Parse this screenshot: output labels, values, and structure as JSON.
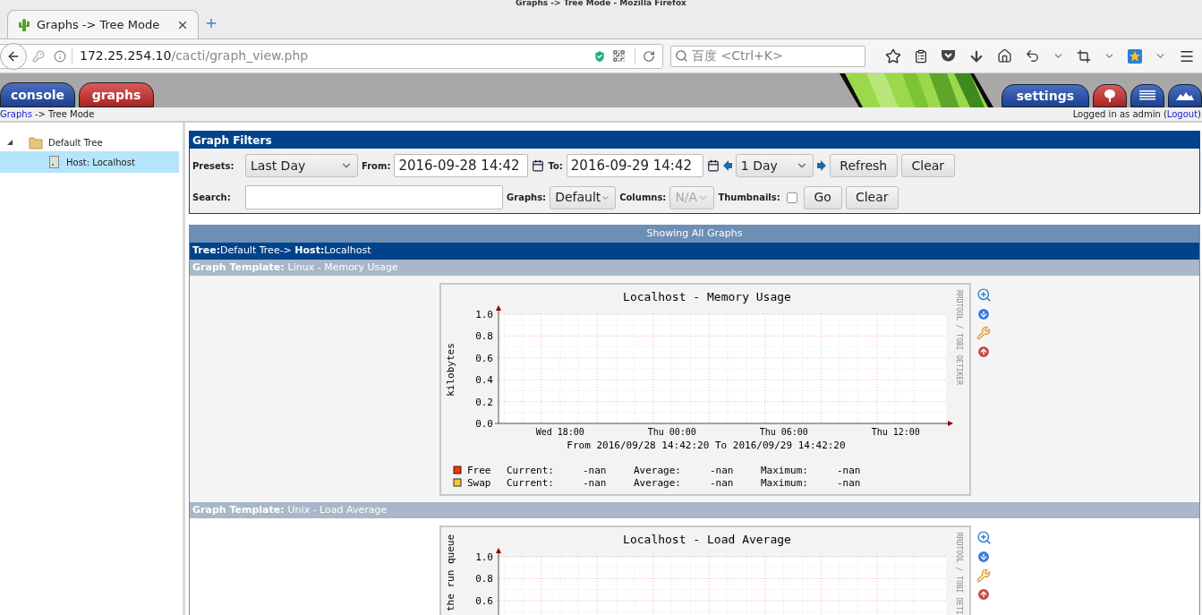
{
  "window": {
    "title": "Graphs -> Tree Mode - Mozilla Firefox"
  },
  "browser": {
    "tabs": [
      {
        "label": "Graphs -> Tree Mode",
        "selected": true
      }
    ],
    "address": {
      "host": "172.25.254.10",
      "path": "/cacti/graph_view.php"
    },
    "search": {
      "placeholder": "百度 <Ctrl+K>"
    }
  },
  "cacti_tabs": [
    {
      "label": "console",
      "selected": false
    },
    {
      "label": "graphs",
      "selected": true
    }
  ],
  "right_tabs": [
    {
      "kind": "text",
      "label": "settings",
      "selected": false
    },
    {
      "kind": "tree",
      "selected": true
    },
    {
      "kind": "list",
      "selected": false
    },
    {
      "kind": "preview",
      "selected": false
    }
  ],
  "breadcrumb": {
    "link": "Graphs",
    "rest": "-> Tree Mode"
  },
  "login": {
    "prefix": "Logged in as admin (",
    "link": "Logout",
    "suffix": ")"
  },
  "tree": [
    {
      "label": "Default Tree",
      "expanded": true,
      "selected": false,
      "children": [
        {
          "label": "Host: Localhost",
          "selected": true
        }
      ]
    }
  ],
  "filters": {
    "title": "Graph Filters",
    "presets_label": "Presets:",
    "preset": "Last Day",
    "from_label": "From:",
    "from": "2016-09-28 14:42",
    "to_label": "To:",
    "to": "2016-09-29 14:42",
    "timespan": "1 Day",
    "buttons": [
      "Refresh",
      "Clear"
    ],
    "search_label": "Search:",
    "graphs_label": "Graphs:",
    "graphs": "Default",
    "columns_label": "Columns:",
    "columns": "N/A",
    "columns_disabled": true,
    "thumbnails_label": "Thumbnails:",
    "thumbnails": false,
    "buttons2": [
      "Go",
      "Clear"
    ]
  },
  "listing": {
    "header": "Showing All Graphs",
    "tree_path": {
      "tree_label": "Tree:",
      "tree": "Default Tree->",
      "host_label": "Host:",
      "host": "Localhost"
    },
    "templates": [
      {
        "label": "Graph Template:",
        "name": "Linux - Memory Usage",
        "graph": {
          "title": "Localhost - Memory Usage",
          "watermark": "RRDTOOL / TOBI OETIKER",
          "subtitle": "From 2016/09/28 14:42:20 To 2016/09/29 14:42:20",
          "chart_data": {
            "type": "line",
            "ylabel": "kilobytes",
            "ylim": [
              0,
              1
            ],
            "grid": true,
            "categories": [
              "Wed 18:00",
              "Thu 00:00",
              "Thu 06:00",
              "Thu 12:00"
            ],
            "yticks": [
              {
                "value": 0,
                "label": "0.0"
              },
              {
                "value": 0.2,
                "label": "0.2"
              },
              {
                "value": 0.4,
                "label": "0.4"
              },
              {
                "value": 0.6,
                "label": "0.6"
              },
              {
                "value": 0.8,
                "label": "0.8"
              },
              {
                "value": 1,
                "label": "1.0"
              }
            ],
            "series": [
              {
                "name": "Free",
                "color": "#ff3300",
                "values": [
                  null,
                  null,
                  null,
                  null
                ]
              },
              {
                "name": "Swap",
                "color": "#ffc73b",
                "values": [
                  null,
                  null,
                  null,
                  null
                ]
              }
            ]
          },
          "legend": [
            {
              "current_label": "Current:",
              "current": "-nan",
              "average_label": "Average:",
              "average": "-nan",
              "maximum_label": "Maximum:",
              "maximum": "-nan"
            },
            {
              "current_label": "Current:",
              "current": "-nan",
              "average_label": "Average:",
              "average": "-nan",
              "maximum_label": "Maximum:",
              "maximum": "-nan"
            }
          ]
        }
      },
      {
        "label": "Graph Template:",
        "name": "Unix - Load Average",
        "graph": {
          "title": "Localhost - Load Average",
          "watermark": "RRDTOOL / TOBI OETI",
          "chart_data": {
            "type": "line",
            "ylabel": "the run queue",
            "ylim": [
              0,
              1
            ],
            "grid": true,
            "categories": [
              null,
              null,
              null,
              null
            ],
            "yticks": [
              {
                "value": 0.6,
                "label": "0.6"
              },
              {
                "value": 0.8,
                "label": "0.8"
              },
              {
                "value": 1,
                "label": "1.0"
              }
            ]
          }
        }
      }
    ]
  }
}
